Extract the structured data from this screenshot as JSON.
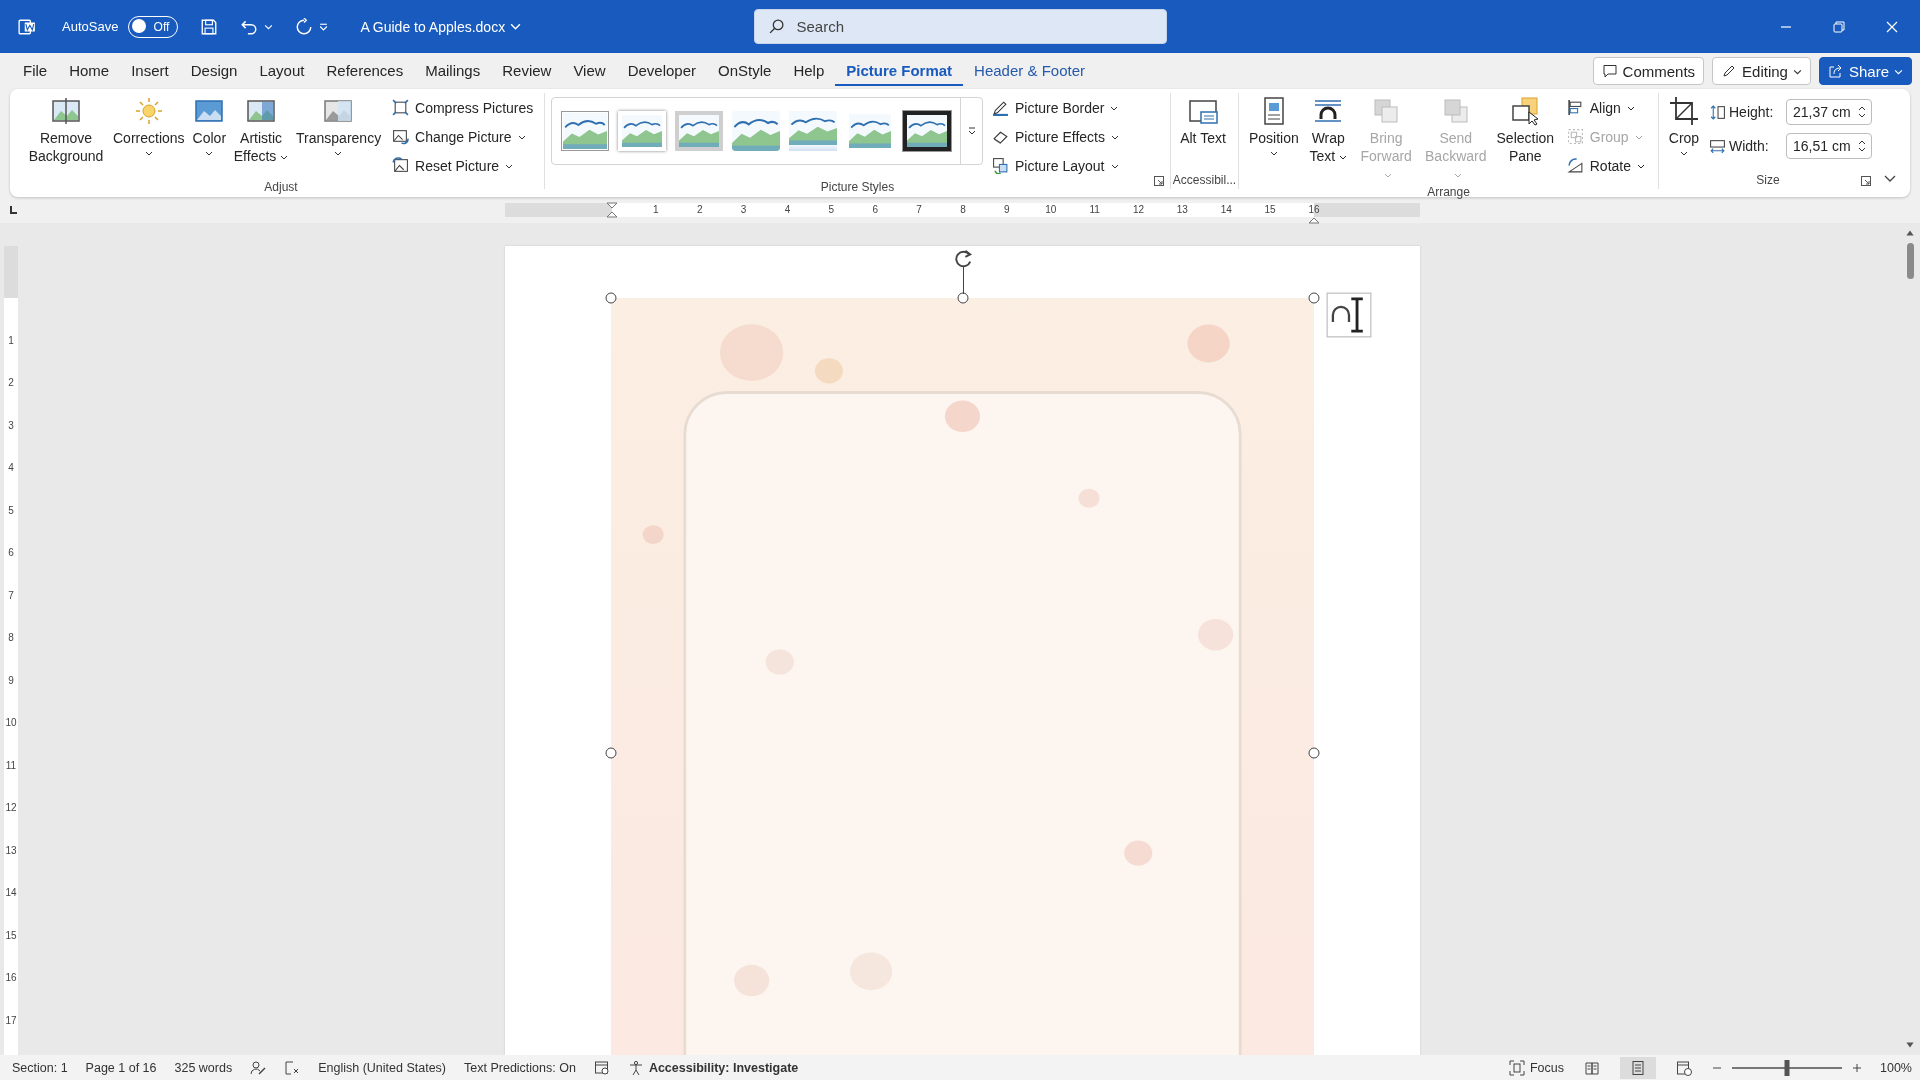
{
  "title_bar": {
    "autosave_label": "AutoSave",
    "autosave_on": false,
    "autosave_state": "Off",
    "document_title": "A Guide to Apples.docx"
  },
  "search": {
    "placeholder": "Search"
  },
  "tabs": [
    {
      "label": "File",
      "selected": false,
      "contextual": false
    },
    {
      "label": "Home",
      "selected": false,
      "contextual": false
    },
    {
      "label": "Insert",
      "selected": false,
      "contextual": false
    },
    {
      "label": "Design",
      "selected": false,
      "contextual": false
    },
    {
      "label": "Layout",
      "selected": false,
      "contextual": false
    },
    {
      "label": "References",
      "selected": false,
      "contextual": false
    },
    {
      "label": "Mailings",
      "selected": false,
      "contextual": false
    },
    {
      "label": "Review",
      "selected": false,
      "contextual": false
    },
    {
      "label": "View",
      "selected": false,
      "contextual": false
    },
    {
      "label": "Developer",
      "selected": false,
      "contextual": false
    },
    {
      "label": "OnStyle",
      "selected": false,
      "contextual": false
    },
    {
      "label": "Help",
      "selected": false,
      "contextual": false
    },
    {
      "label": "Picture Format",
      "selected": true,
      "contextual": true
    },
    {
      "label": "Header & Footer",
      "selected": false,
      "contextual": true
    }
  ],
  "actions": {
    "comments": "Comments",
    "editing": "Editing",
    "share": "Share"
  },
  "adjust": {
    "label": "Adjust",
    "buttons": [
      {
        "label": "Remove Background",
        "menu": false
      },
      {
        "label": "Corrections",
        "menu": true
      },
      {
        "label": "Color",
        "menu": true
      },
      {
        "label": "Artistic Effects",
        "menu": true
      },
      {
        "label": "Transparency",
        "menu": true
      }
    ],
    "commands": [
      {
        "label": "Compress Pictures",
        "menu": false
      },
      {
        "label": "Change Picture",
        "menu": true
      },
      {
        "label": "Reset Picture",
        "menu": true
      }
    ]
  },
  "picture_styles": {
    "label": "Picture Styles",
    "styles": [
      {
        "kind": "thin"
      },
      {
        "kind": "white"
      },
      {
        "kind": "grey"
      },
      {
        "kind": "soft"
      },
      {
        "kind": "reflected"
      },
      {
        "kind": "feathered"
      },
      {
        "kind": "black"
      }
    ],
    "commands": [
      {
        "label": "Picture Border",
        "menu": true
      },
      {
        "label": "Picture Effects",
        "menu": true
      },
      {
        "label": "Picture Layout",
        "menu": true
      }
    ]
  },
  "accessibility": {
    "label": "Accessibil...",
    "buttons": [
      {
        "label": "Alt Text"
      }
    ]
  },
  "arrange": {
    "label": "Arrange",
    "buttons": [
      {
        "label": "Position",
        "menu": true,
        "disabled": false
      },
      {
        "label": "Wrap Text",
        "menu": true,
        "disabled": false
      },
      {
        "label": "Bring Forward",
        "menu": true,
        "disabled": true
      },
      {
        "label": "Send Backward",
        "menu": true,
        "disabled": true
      },
      {
        "label": "Selection Pane",
        "menu": false,
        "disabled": false
      }
    ],
    "commands": [
      {
        "label": "Align",
        "menu": true,
        "disabled": false
      },
      {
        "label": "Group",
        "menu": true,
        "disabled": true
      },
      {
        "label": "Rotate",
        "menu": true,
        "disabled": false
      }
    ]
  },
  "size": {
    "label": "Size",
    "buttons": [
      {
        "label": "Crop",
        "menu": true
      }
    ],
    "fields": [
      {
        "label": "Height:",
        "value": "21,37 cm"
      },
      {
        "label": "Width:",
        "value": "16,51 cm"
      }
    ]
  },
  "ruler": {
    "horizontal": [
      "1",
      "2",
      "3",
      "4",
      "5",
      "6",
      "7",
      "8",
      "9",
      "10",
      "11",
      "12",
      "13",
      "14",
      "15",
      "16"
    ],
    "vertical": [
      "1",
      "2",
      "3",
      "4",
      "5",
      "6",
      "7",
      "8",
      "9",
      "10",
      "11",
      "12",
      "13",
      "14",
      "15",
      "16",
      "17"
    ]
  },
  "status_bar": {
    "section": "Section: 1",
    "page": "Page 1 of 16",
    "words": "325 words",
    "language": "English (United States)",
    "predictions": "Text Predictions: On",
    "accessibility": "Accessibility: Investigate",
    "focus": "Focus",
    "views": [
      {
        "kind": "read",
        "selected": false
      },
      {
        "kind": "print",
        "selected": true
      },
      {
        "kind": "web",
        "selected": false
      }
    ],
    "zoom": {
      "level": 0.5,
      "reading": "100%"
    }
  }
}
